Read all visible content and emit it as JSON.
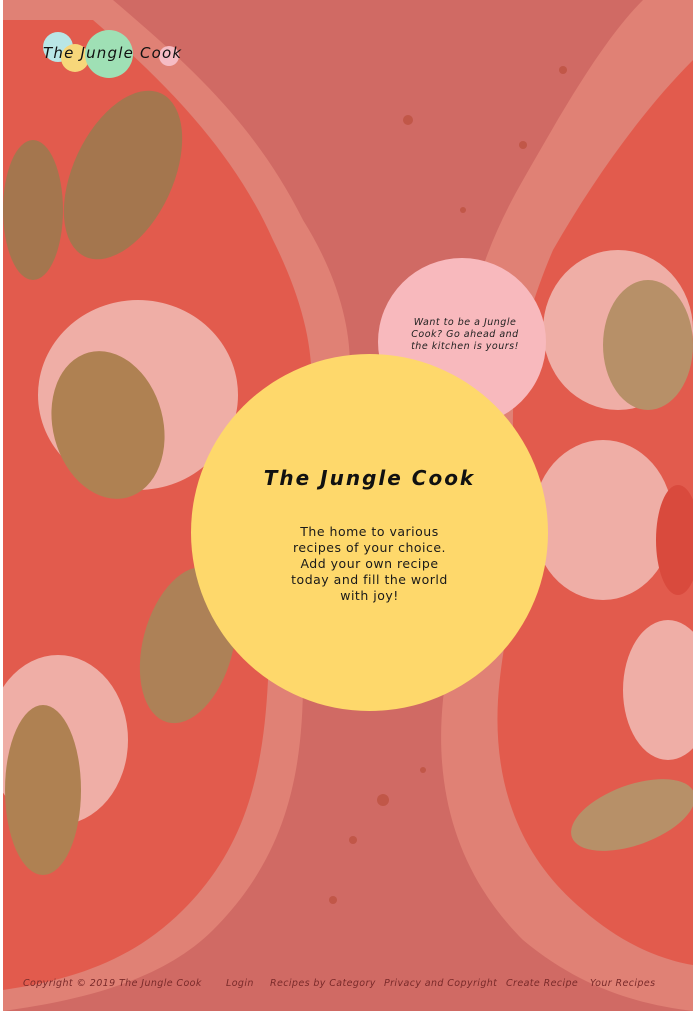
{
  "brand": {
    "logo_text": "The Jungle Cook",
    "dot_colors": [
      "#b9e6e6",
      "#f7d77a",
      "#9fe0b5",
      "#f6bcc4"
    ]
  },
  "hero": {
    "background_icon": "pizza-photo",
    "overlay_color": "#e5706e",
    "bubble_text": "Want to be a Jungle Cook? Go ahead and the kitchen is yours!",
    "bubble_color": "#f8b9bd",
    "title": "The Jungle Cook",
    "tagline": "The home to various recipes of your choice. Add your own recipe today and fill the world with joy!",
    "panel_color": "#fed86b"
  },
  "footer": {
    "copyright": "Copyright © 2019 The Jungle Cook",
    "links": [
      "Login",
      "Recipes by Category",
      "Privacy and Copyright",
      "Create Recipe",
      "Your Recipes"
    ],
    "text_color": "#7a2a2a"
  }
}
